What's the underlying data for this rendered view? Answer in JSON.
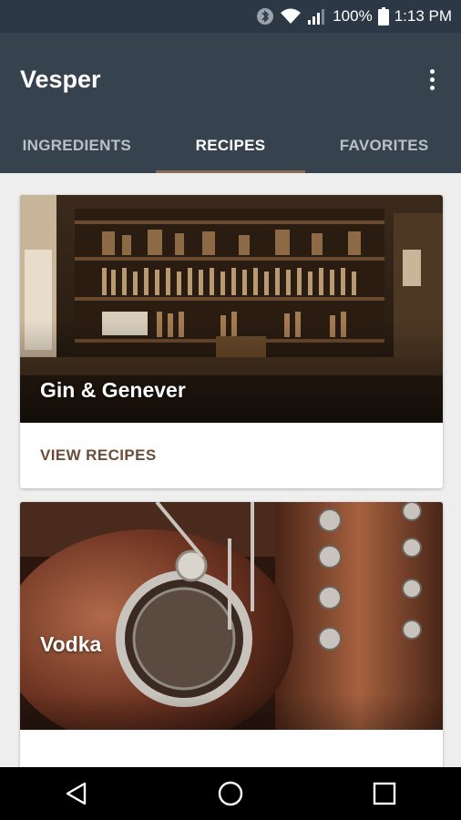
{
  "status_bar": {
    "battery_text": "100%",
    "time": "1:13 PM"
  },
  "app_bar": {
    "title": "Vesper"
  },
  "tabs": [
    {
      "label": "INGREDIENTS"
    },
    {
      "label": "RECIPES"
    },
    {
      "label": "FAVORITES"
    }
  ],
  "cards": [
    {
      "title": "Gin & Genever",
      "action": "VIEW RECIPES"
    },
    {
      "title": "Vodka"
    }
  ],
  "colors": {
    "status_bar": "#2c3845",
    "app_bar": "#36434f",
    "tab_indicator": "#8a6a55",
    "action_text": "#6d4d3a"
  }
}
